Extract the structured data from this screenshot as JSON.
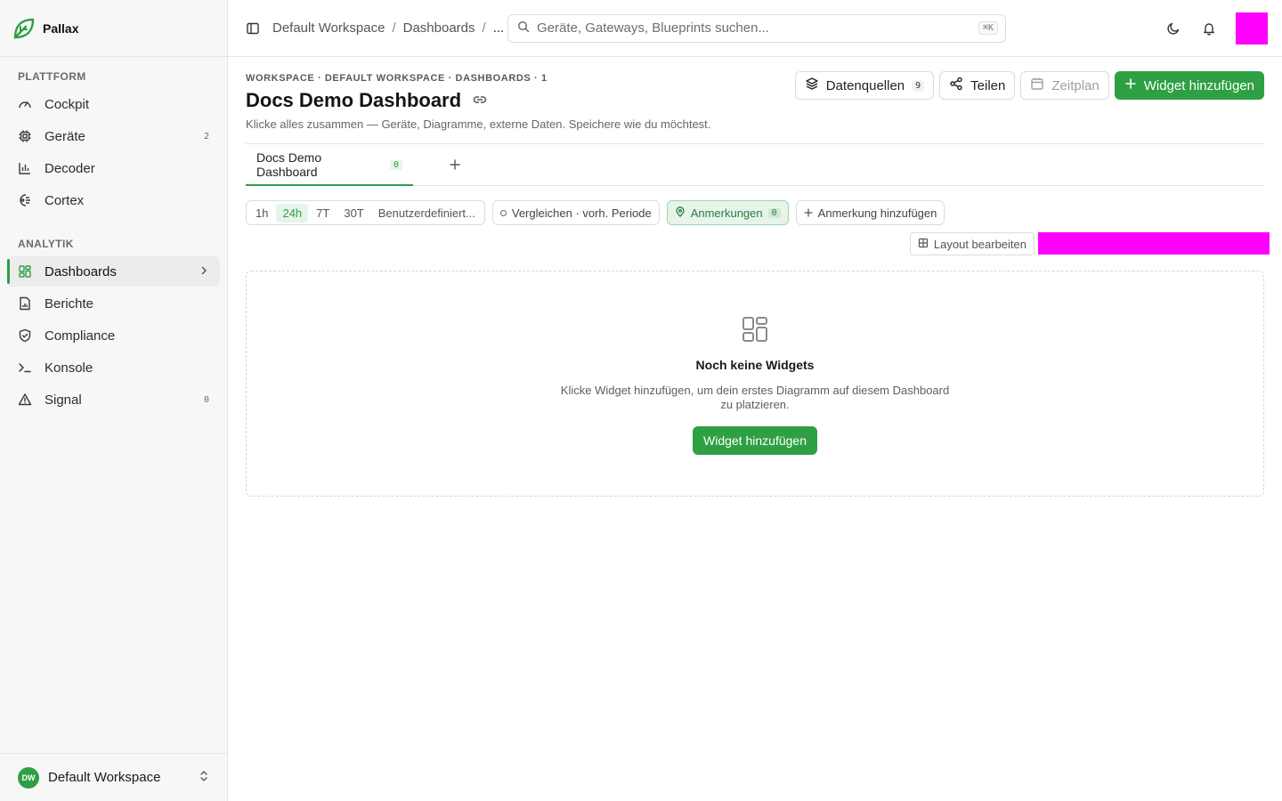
{
  "app": {
    "name": "Pallax"
  },
  "sidebar": {
    "sections": [
      {
        "label": "PLATTFORM"
      },
      {
        "label": "ANALYTIK"
      }
    ],
    "items": [
      {
        "label": "Cockpit",
        "icon": "gauge-icon"
      },
      {
        "label": "Geräte",
        "icon": "chip-icon",
        "badge": "2"
      },
      {
        "label": "Decoder",
        "icon": "bar-chart-icon"
      },
      {
        "label": "Cortex",
        "icon": "brain-icon"
      },
      {
        "label": "Dashboards",
        "icon": "grid-icon",
        "active": true
      },
      {
        "label": "Berichte",
        "icon": "file-chart-icon"
      },
      {
        "label": "Compliance",
        "icon": "shield-check-icon"
      },
      {
        "label": "Konsole",
        "icon": "terminal-icon"
      },
      {
        "label": "Signal",
        "icon": "alert-triangle-icon",
        "badge": "0"
      }
    ],
    "workspace": {
      "initials": "DW",
      "name": "Default Workspace"
    }
  },
  "topbar": {
    "breadcrumb": [
      "Default Workspace",
      "Dashboards",
      "..."
    ],
    "search": {
      "placeholder": "Geräte, Gateways, Blueprints suchen...",
      "shortcut": "⌘K"
    }
  },
  "header": {
    "eyebrow": "WORKSPACE · DEFAULT WORKSPACE · DASHBOARDS · 1",
    "title": "Docs Demo Dashboard",
    "subtitle": "Klicke alles zusammen — Geräte, Diagramme, externe Daten. Speichere wie du möchtest.",
    "actions": {
      "datasources": {
        "label": "Datenquellen",
        "count": "9"
      },
      "share": {
        "label": "Teilen"
      },
      "schedule": {
        "label": "Zeitplan"
      },
      "add_widget": {
        "label": "Widget hinzufügen"
      }
    }
  },
  "tabs": [
    {
      "label": "Docs Demo Dashboard",
      "count": "0"
    }
  ],
  "filters": {
    "ranges": [
      "1h",
      "24h",
      "7T",
      "30T",
      "Benutzerdefiniert..."
    ],
    "active_range": "24h",
    "compare": "Vergleichen · vorh. Periode",
    "annotations": {
      "label": "Anmerkungen",
      "count": "0"
    },
    "add_annotation": "Anmerkung hinzufügen"
  },
  "layout": {
    "edit_label": "Layout bearbeiten"
  },
  "empty_state": {
    "title": "Noch keine Widgets",
    "description": "Klicke Widget hinzufügen, um dein erstes Diagramm auf diesem Dashboard zu platzieren.",
    "button": "Widget hinzufügen"
  },
  "colors": {
    "accent": "#2ea043",
    "redaction": "#ff00ff"
  }
}
